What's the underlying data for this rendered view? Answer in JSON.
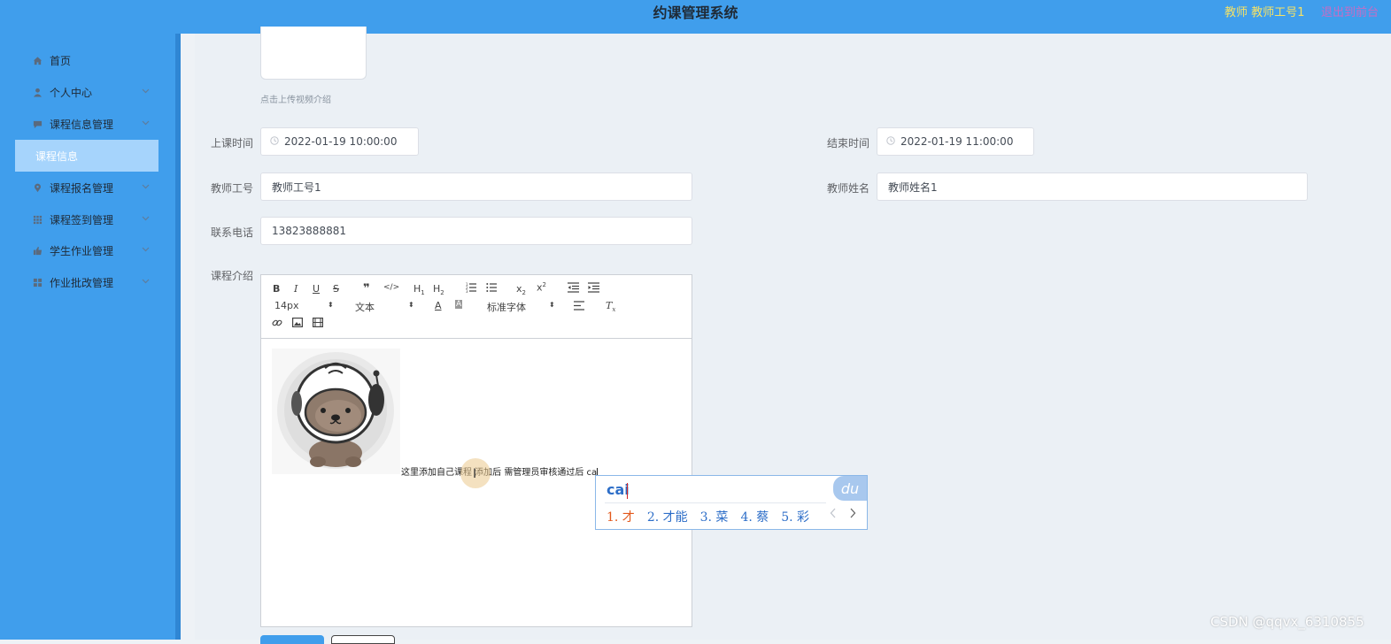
{
  "header": {
    "title": "约课管理系统",
    "user": "教师 教师工号1",
    "exit": "退出到前台"
  },
  "sidebar": {
    "items": [
      {
        "label": "首页",
        "icon": "home-icon"
      },
      {
        "label": "个人中心",
        "icon": "user-icon"
      },
      {
        "label": "课程信息管理",
        "icon": "chat-icon"
      },
      {
        "label": "课程报名管理",
        "icon": "location-icon"
      },
      {
        "label": "课程签到管理",
        "icon": "grid-icon"
      },
      {
        "label": "学生作业管理",
        "icon": "thumb-icon"
      },
      {
        "label": "作业批改管理",
        "icon": "menu-icon"
      }
    ],
    "sub_item": "课程信息"
  },
  "form": {
    "upload_tip": "点击上传视频介绍",
    "start_label": "上课时间",
    "start_value": "2022-01-19 10:00:00",
    "end_label": "结束时间",
    "end_value": "2022-01-19 11:00:00",
    "teacher_id_label": "教师工号",
    "teacher_id_value": "教师工号1",
    "teacher_name_label": "教师姓名",
    "teacher_name_value": "教师姓名1",
    "phone_label": "联系电话",
    "phone_value": "13823888881",
    "intro_label": "课程介绍"
  },
  "editor": {
    "toolbar": {
      "size": "14px",
      "type": "文本",
      "font": "标准字体"
    },
    "content_text": "这里添加自己课程 添加后 需管理员审核通过后 ca"
  },
  "ime": {
    "composition": "cai",
    "logo": "du",
    "candidates": [
      "1. 才",
      "2. 才能",
      "3. 菜",
      "4. 蔡",
      "5. 彩"
    ]
  },
  "watermark": "CSDN @qqvx_6310855",
  "colors": {
    "header": "#409eec",
    "sidebar": "#409eec",
    "active_sub": "#a6d4fc",
    "user_text": "#f5e266",
    "exit_text": "#c86cc4"
  }
}
